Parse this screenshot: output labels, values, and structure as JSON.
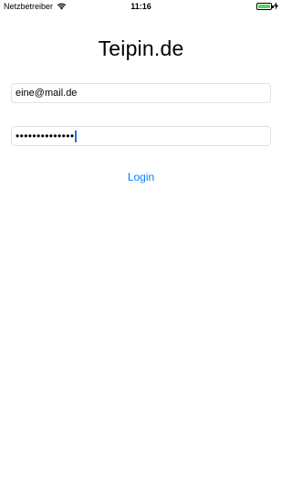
{
  "status_bar": {
    "carrier": "Netzbetreiber",
    "time": "11:16",
    "wifi_icon": "wifi-icon",
    "battery_icon": "battery-icon",
    "battery_color": "#4cd964",
    "charging_icon": "charging-bolt-icon"
  },
  "app": {
    "title": "Teipin.de"
  },
  "form": {
    "email_value": "eine@mail.de",
    "password_value": "••••••••••••••",
    "login_label": "Login",
    "accent_color": "#0a7aff"
  }
}
